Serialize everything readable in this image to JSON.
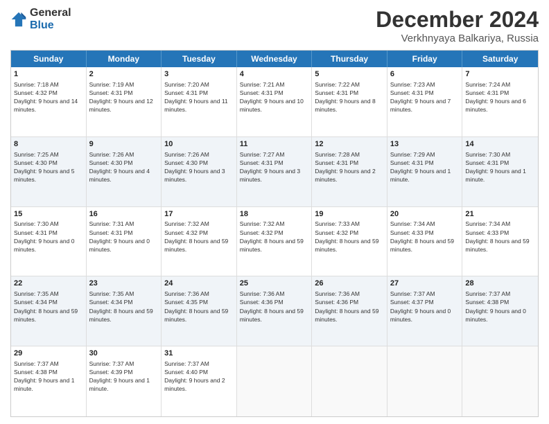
{
  "logo": {
    "general": "General",
    "blue": "Blue"
  },
  "title": "December 2024",
  "location": "Verkhnyaya Balkariya, Russia",
  "days_of_week": [
    "Sunday",
    "Monday",
    "Tuesday",
    "Wednesday",
    "Thursday",
    "Friday",
    "Saturday"
  ],
  "weeks": [
    [
      {
        "day": "1",
        "sunrise": "Sunrise: 7:18 AM",
        "sunset": "Sunset: 4:32 PM",
        "daylight": "Daylight: 9 hours and 14 minutes."
      },
      {
        "day": "2",
        "sunrise": "Sunrise: 7:19 AM",
        "sunset": "Sunset: 4:31 PM",
        "daylight": "Daylight: 9 hours and 12 minutes."
      },
      {
        "day": "3",
        "sunrise": "Sunrise: 7:20 AM",
        "sunset": "Sunset: 4:31 PM",
        "daylight": "Daylight: 9 hours and 11 minutes."
      },
      {
        "day": "4",
        "sunrise": "Sunrise: 7:21 AM",
        "sunset": "Sunset: 4:31 PM",
        "daylight": "Daylight: 9 hours and 10 minutes."
      },
      {
        "day": "5",
        "sunrise": "Sunrise: 7:22 AM",
        "sunset": "Sunset: 4:31 PM",
        "daylight": "Daylight: 9 hours and 8 minutes."
      },
      {
        "day": "6",
        "sunrise": "Sunrise: 7:23 AM",
        "sunset": "Sunset: 4:31 PM",
        "daylight": "Daylight: 9 hours and 7 minutes."
      },
      {
        "day": "7",
        "sunrise": "Sunrise: 7:24 AM",
        "sunset": "Sunset: 4:31 PM",
        "daylight": "Daylight: 9 hours and 6 minutes."
      }
    ],
    [
      {
        "day": "8",
        "sunrise": "Sunrise: 7:25 AM",
        "sunset": "Sunset: 4:30 PM",
        "daylight": "Daylight: 9 hours and 5 minutes."
      },
      {
        "day": "9",
        "sunrise": "Sunrise: 7:26 AM",
        "sunset": "Sunset: 4:30 PM",
        "daylight": "Daylight: 9 hours and 4 minutes."
      },
      {
        "day": "10",
        "sunrise": "Sunrise: 7:26 AM",
        "sunset": "Sunset: 4:30 PM",
        "daylight": "Daylight: 9 hours and 3 minutes."
      },
      {
        "day": "11",
        "sunrise": "Sunrise: 7:27 AM",
        "sunset": "Sunset: 4:31 PM",
        "daylight": "Daylight: 9 hours and 3 minutes."
      },
      {
        "day": "12",
        "sunrise": "Sunrise: 7:28 AM",
        "sunset": "Sunset: 4:31 PM",
        "daylight": "Daylight: 9 hours and 2 minutes."
      },
      {
        "day": "13",
        "sunrise": "Sunrise: 7:29 AM",
        "sunset": "Sunset: 4:31 PM",
        "daylight": "Daylight: 9 hours and 1 minute."
      },
      {
        "day": "14",
        "sunrise": "Sunrise: 7:30 AM",
        "sunset": "Sunset: 4:31 PM",
        "daylight": "Daylight: 9 hours and 1 minute."
      }
    ],
    [
      {
        "day": "15",
        "sunrise": "Sunrise: 7:30 AM",
        "sunset": "Sunset: 4:31 PM",
        "daylight": "Daylight: 9 hours and 0 minutes."
      },
      {
        "day": "16",
        "sunrise": "Sunrise: 7:31 AM",
        "sunset": "Sunset: 4:31 PM",
        "daylight": "Daylight: 9 hours and 0 minutes."
      },
      {
        "day": "17",
        "sunrise": "Sunrise: 7:32 AM",
        "sunset": "Sunset: 4:32 PM",
        "daylight": "Daylight: 8 hours and 59 minutes."
      },
      {
        "day": "18",
        "sunrise": "Sunrise: 7:32 AM",
        "sunset": "Sunset: 4:32 PM",
        "daylight": "Daylight: 8 hours and 59 minutes."
      },
      {
        "day": "19",
        "sunrise": "Sunrise: 7:33 AM",
        "sunset": "Sunset: 4:32 PM",
        "daylight": "Daylight: 8 hours and 59 minutes."
      },
      {
        "day": "20",
        "sunrise": "Sunrise: 7:34 AM",
        "sunset": "Sunset: 4:33 PM",
        "daylight": "Daylight: 8 hours and 59 minutes."
      },
      {
        "day": "21",
        "sunrise": "Sunrise: 7:34 AM",
        "sunset": "Sunset: 4:33 PM",
        "daylight": "Daylight: 8 hours and 59 minutes."
      }
    ],
    [
      {
        "day": "22",
        "sunrise": "Sunrise: 7:35 AM",
        "sunset": "Sunset: 4:34 PM",
        "daylight": "Daylight: 8 hours and 59 minutes."
      },
      {
        "day": "23",
        "sunrise": "Sunrise: 7:35 AM",
        "sunset": "Sunset: 4:34 PM",
        "daylight": "Daylight: 8 hours and 59 minutes."
      },
      {
        "day": "24",
        "sunrise": "Sunrise: 7:36 AM",
        "sunset": "Sunset: 4:35 PM",
        "daylight": "Daylight: 8 hours and 59 minutes."
      },
      {
        "day": "25",
        "sunrise": "Sunrise: 7:36 AM",
        "sunset": "Sunset: 4:36 PM",
        "daylight": "Daylight: 8 hours and 59 minutes."
      },
      {
        "day": "26",
        "sunrise": "Sunrise: 7:36 AM",
        "sunset": "Sunset: 4:36 PM",
        "daylight": "Daylight: 8 hours and 59 minutes."
      },
      {
        "day": "27",
        "sunrise": "Sunrise: 7:37 AM",
        "sunset": "Sunset: 4:37 PM",
        "daylight": "Daylight: 9 hours and 0 minutes."
      },
      {
        "day": "28",
        "sunrise": "Sunrise: 7:37 AM",
        "sunset": "Sunset: 4:38 PM",
        "daylight": "Daylight: 9 hours and 0 minutes."
      }
    ],
    [
      {
        "day": "29",
        "sunrise": "Sunrise: 7:37 AM",
        "sunset": "Sunset: 4:38 PM",
        "daylight": "Daylight: 9 hours and 1 minute."
      },
      {
        "day": "30",
        "sunrise": "Sunrise: 7:37 AM",
        "sunset": "Sunset: 4:39 PM",
        "daylight": "Daylight: 9 hours and 1 minute."
      },
      {
        "day": "31",
        "sunrise": "Sunrise: 7:37 AM",
        "sunset": "Sunset: 4:40 PM",
        "daylight": "Daylight: 9 hours and 2 minutes."
      },
      {
        "day": "",
        "sunrise": "",
        "sunset": "",
        "daylight": ""
      },
      {
        "day": "",
        "sunrise": "",
        "sunset": "",
        "daylight": ""
      },
      {
        "day": "",
        "sunrise": "",
        "sunset": "",
        "daylight": ""
      },
      {
        "day": "",
        "sunrise": "",
        "sunset": "",
        "daylight": ""
      }
    ]
  ]
}
